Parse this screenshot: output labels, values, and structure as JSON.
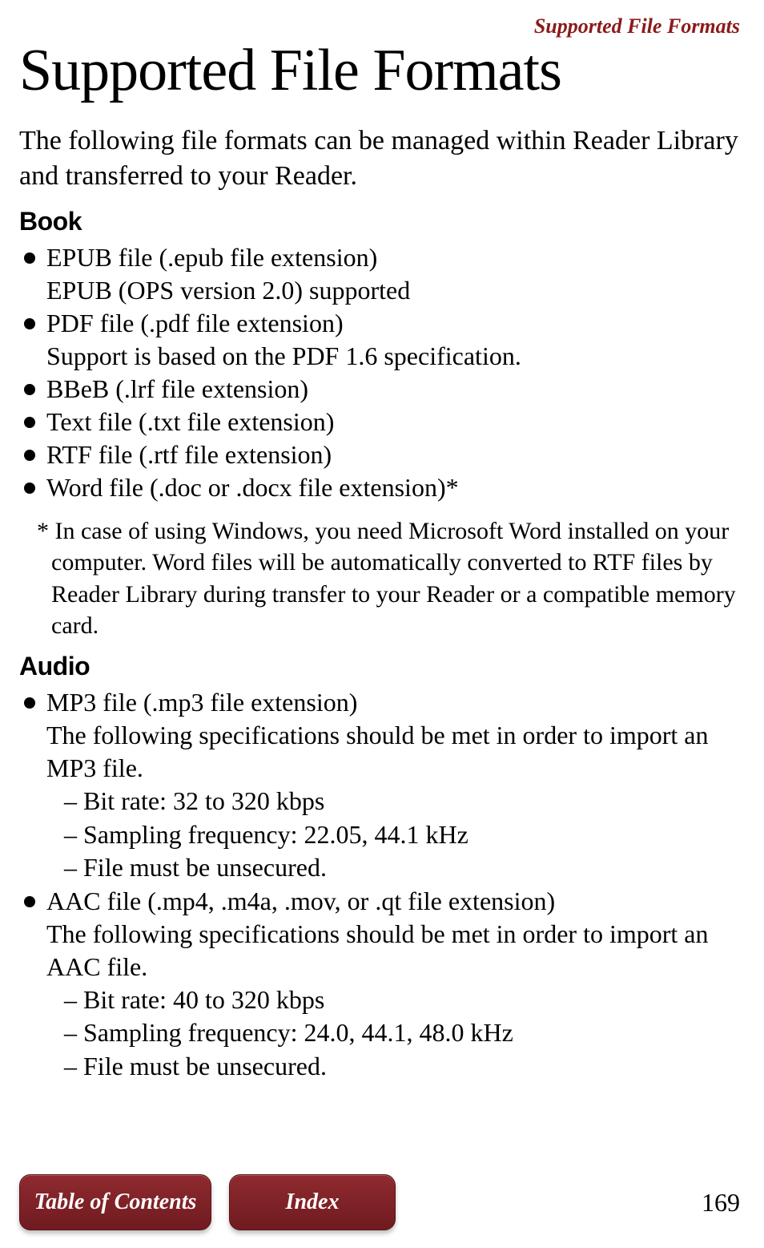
{
  "running_head": "Supported File Formats",
  "title": "Supported File Formats",
  "intro": "The following file formats can be managed within Reader Library and transferred to your Reader.",
  "book": {
    "heading": "Book",
    "items": [
      {
        "line1": "EPUB file (.epub file extension)",
        "line2": "EPUB (OPS version 2.0) supported"
      },
      {
        "line1": "PDF file (.pdf file extension)",
        "line2": "Support is based on the PDF 1.6 specification."
      },
      {
        "line1": "BBeB (.lrf file extension)"
      },
      {
        "line1": "Text file (.txt file extension)"
      },
      {
        "line1": "RTF file (.rtf file extension)"
      },
      {
        "line1": "Word file (.doc or .docx file extension)*"
      }
    ],
    "footnote": "* In case of using Windows, you need Microsoft Word installed on your computer. Word files will be automatically converted to RTF files by Reader Library during transfer to your Reader or a compatible memory card."
  },
  "audio": {
    "heading": "Audio",
    "items": [
      {
        "line1": "MP3 file (.mp3 file extension)",
        "desc": "The following specifications should be met in order to import an MP3 file.",
        "specs": [
          "Bit rate: 32 to 320 kbps",
          "Sampling frequency: 22.05, 44.1 kHz",
          "File must be unsecured."
        ]
      },
      {
        "line1": "AAC file (.mp4, .m4a, .mov, or .qt file extension)",
        "desc": "The following specifications should be met in order to import an AAC file.",
        "specs": [
          "Bit rate: 40 to 320 kbps",
          "Sampling frequency: 24.0, 44.1, 48.0 kHz",
          "File must be unsecured."
        ]
      }
    ]
  },
  "footer": {
    "toc_label": "Table of Contents",
    "index_label": "Index",
    "page_number": "169"
  }
}
